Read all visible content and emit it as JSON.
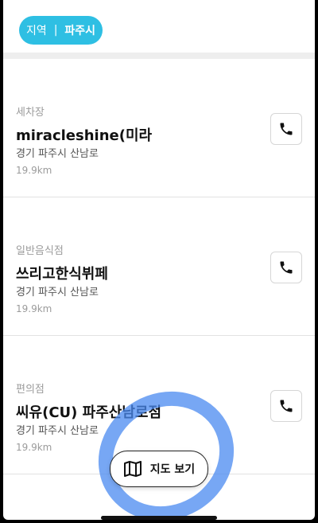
{
  "header": {
    "region_key": "지역",
    "separator": "|",
    "region_value": "파주시"
  },
  "stores": [
    {
      "category": "세차장",
      "name": "miracleshine(미라",
      "address": "경기 파주시 산남로",
      "distance": "19.9km"
    },
    {
      "category": "일반음식점",
      "name": "쓰리고한식뷔페",
      "address": "경기 파주시 산남로",
      "distance": "19.9km"
    },
    {
      "category": "편의점",
      "name": "씨유(CU) 파주산남로점",
      "address": "경기 파주시 산남로",
      "distance": "19.9km"
    }
  ],
  "map_button": {
    "label": "지도 보기",
    "icon": "map-icon"
  },
  "colors": {
    "accent": "#2ebfe3",
    "highlight": "#4a8af0"
  }
}
